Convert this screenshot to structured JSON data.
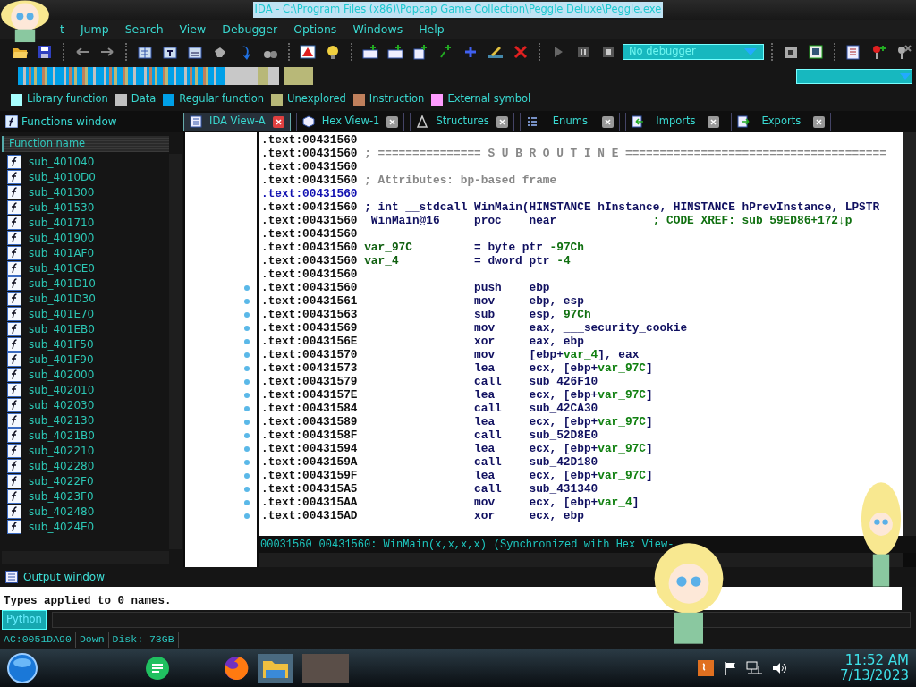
{
  "window": {
    "title": "IDA - C:\\Program Files (x86)\\Popcap Game Collection\\Peggle Deluxe\\Peggle.exe"
  },
  "menu": [
    "t",
    "Jump",
    "Search",
    "View",
    "Debugger",
    "Options",
    "Windows",
    "Help"
  ],
  "debugger_select": {
    "value": "No debugger"
  },
  "legend": [
    {
      "label": "Library function",
      "color": "#a8ffff"
    },
    {
      "label": "Data",
      "color": "#c0c0c0"
    },
    {
      "label": "Regular function",
      "color": "#00a0e8"
    },
    {
      "label": "Unexplored",
      "color": "#b8b878"
    },
    {
      "label": "Instruction",
      "color": "#c0805c"
    },
    {
      "label": "External symbol",
      "color": "#ff9cff"
    }
  ],
  "functions_window": {
    "title": "Functions window",
    "column": "Function name",
    "items": [
      "sub_401040",
      "sub_4010D0",
      "sub_401300",
      "sub_401530",
      "sub_401710",
      "sub_401900",
      "sub_401AF0",
      "sub_401CE0",
      "sub_401D10",
      "sub_401D30",
      "sub_401E70",
      "sub_401EB0",
      "sub_401F50",
      "sub_401F90",
      "sub_402000",
      "sub_402010",
      "sub_402030",
      "sub_402130",
      "sub_4021B0",
      "sub_402210",
      "sub_402280",
      "sub_4022F0",
      "sub_4023F0",
      "sub_402480",
      "sub_4024E0"
    ]
  },
  "tabs": [
    {
      "label": "IDA View-A",
      "selected": true,
      "kind": "listing"
    },
    {
      "label": "Hex View-1",
      "selected": false,
      "kind": "hex"
    },
    {
      "label": "Structures",
      "selected": false,
      "kind": "struct"
    },
    {
      "label": "Enums",
      "selected": false,
      "kind": "enum"
    },
    {
      "label": "Imports",
      "selected": false,
      "kind": "imports"
    },
    {
      "label": "Exports",
      "selected": false,
      "kind": "exports"
    }
  ],
  "listing": {
    "lines": [
      {
        "addr": ".text:00431560",
        "selected": false
      },
      {
        "addr": ".text:00431560",
        "selected": false,
        "comment": "; =============== S U B R O U T I N E ======================================",
        "dark": false
      },
      {
        "addr": ".text:00431560",
        "selected": false
      },
      {
        "addr": ".text:00431560",
        "selected": false,
        "comment": "; Attributes: bp-based frame",
        "dark": false
      },
      {
        "addr": ".text:00431560",
        "selected": true
      },
      {
        "addr": ".text:00431560",
        "selected": false,
        "comment": "; int __stdcall WinMain(HINSTANCE hInstance, HINSTANCE hPrevInstance, LPSTR",
        "dark": true
      },
      {
        "addr": ".text:00431560",
        "selected": false,
        "label": "_WinMain@16",
        "var": false,
        "code": [
          {
            "kind": "mnem",
            "text": "proc"
          },
          {
            "kind": "op",
            "text": "near"
          }
        ],
        "comment": "; CODE XREF: sub_59ED86+172↓p"
      },
      {
        "addr": ".text:00431560",
        "selected": false
      },
      {
        "addr": ".text:00431560",
        "selected": false,
        "label": "var_97C",
        "var": true,
        "code": [
          {
            "kind": "op",
            "text": "= byte ptr "
          },
          {
            "kind": "num",
            "text": "-97Ch"
          }
        ]
      },
      {
        "addr": ".text:00431560",
        "selected": false,
        "label": "var_4",
        "var": true,
        "code": [
          {
            "kind": "op",
            "text": "= dword ptr "
          },
          {
            "kind": "num",
            "text": "-4"
          }
        ]
      },
      {
        "addr": ".text:00431560",
        "selected": false
      },
      {
        "addr": ".text:00431560",
        "selected": false,
        "dot": true,
        "code": [
          {
            "kind": "mnem",
            "text": "push"
          },
          {
            "kind": "op",
            "text": "ebp"
          }
        ]
      },
      {
        "addr": ".text:00431561",
        "selected": false,
        "dot": true,
        "code": [
          {
            "kind": "mnem",
            "text": "mov"
          },
          {
            "kind": "op",
            "text": "ebp, esp"
          }
        ]
      },
      {
        "addr": ".text:00431563",
        "selected": false,
        "dot": true,
        "code": [
          {
            "kind": "mnem",
            "text": "sub"
          },
          {
            "kind": "op",
            "text": "esp, "
          },
          {
            "kind": "num",
            "text": "97Ch"
          }
        ]
      },
      {
        "addr": ".text:00431569",
        "selected": false,
        "dot": true,
        "code": [
          {
            "kind": "mnem",
            "text": "mov"
          },
          {
            "kind": "op",
            "text": "eax, ___security_cookie"
          }
        ]
      },
      {
        "addr": ".text:0043156E",
        "selected": false,
        "dot": true,
        "code": [
          {
            "kind": "mnem",
            "text": "xor"
          },
          {
            "kind": "op",
            "text": "eax, ebp"
          }
        ]
      },
      {
        "addr": ".text:00431570",
        "selected": false,
        "dot": true,
        "code": [
          {
            "kind": "mnem",
            "text": "mov"
          },
          {
            "kind": "op",
            "text": "[ebp+"
          },
          {
            "kind": "var",
            "text": "var_4"
          },
          {
            "kind": "op",
            "text": "], eax"
          }
        ]
      },
      {
        "addr": ".text:00431573",
        "selected": false,
        "dot": true,
        "code": [
          {
            "kind": "mnem",
            "text": "lea"
          },
          {
            "kind": "op",
            "text": "ecx, [ebp+"
          },
          {
            "kind": "var",
            "text": "var_97C"
          },
          {
            "kind": "op",
            "text": "]"
          }
        ]
      },
      {
        "addr": ".text:00431579",
        "selected": false,
        "dot": true,
        "code": [
          {
            "kind": "mnem",
            "text": "call"
          },
          {
            "kind": "op",
            "text": "sub_426F10"
          }
        ]
      },
      {
        "addr": ".text:0043157E",
        "selected": false,
        "dot": true,
        "code": [
          {
            "kind": "mnem",
            "text": "lea"
          },
          {
            "kind": "op",
            "text": "ecx, [ebp+"
          },
          {
            "kind": "var",
            "text": "var_97C"
          },
          {
            "kind": "op",
            "text": "]"
          }
        ]
      },
      {
        "addr": ".text:00431584",
        "selected": false,
        "dot": true,
        "code": [
          {
            "kind": "mnem",
            "text": "call"
          },
          {
            "kind": "op",
            "text": "sub_42CA30"
          }
        ]
      },
      {
        "addr": ".text:00431589",
        "selected": false,
        "dot": true,
        "code": [
          {
            "kind": "mnem",
            "text": "lea"
          },
          {
            "kind": "op",
            "text": "ecx, [ebp+"
          },
          {
            "kind": "var",
            "text": "var_97C"
          },
          {
            "kind": "op",
            "text": "]"
          }
        ]
      },
      {
        "addr": ".text:0043158F",
        "selected": false,
        "dot": true,
        "code": [
          {
            "kind": "mnem",
            "text": "call"
          },
          {
            "kind": "op",
            "text": "sub_52D8E0"
          }
        ]
      },
      {
        "addr": ".text:00431594",
        "selected": false,
        "dot": true,
        "code": [
          {
            "kind": "mnem",
            "text": "lea"
          },
          {
            "kind": "op",
            "text": "ecx, [ebp+"
          },
          {
            "kind": "var",
            "text": "var_97C"
          },
          {
            "kind": "op",
            "text": "]"
          }
        ]
      },
      {
        "addr": ".text:0043159A",
        "selected": false,
        "dot": true,
        "code": [
          {
            "kind": "mnem",
            "text": "call"
          },
          {
            "kind": "op",
            "text": "sub_42D180"
          }
        ]
      },
      {
        "addr": ".text:0043159F",
        "selected": false,
        "dot": true,
        "code": [
          {
            "kind": "mnem",
            "text": "lea"
          },
          {
            "kind": "op",
            "text": "ecx, [ebp+"
          },
          {
            "kind": "var",
            "text": "var_97C"
          },
          {
            "kind": "op",
            "text": "]"
          }
        ]
      },
      {
        "addr": ".text:004315A5",
        "selected": false,
        "dot": true,
        "code": [
          {
            "kind": "mnem",
            "text": "call"
          },
          {
            "kind": "op",
            "text": "sub_431340"
          }
        ]
      },
      {
        "addr": ".text:004315AA",
        "selected": false,
        "dot": true,
        "code": [
          {
            "kind": "mnem",
            "text": "mov"
          },
          {
            "kind": "op",
            "text": "ecx, [ebp+"
          },
          {
            "kind": "var",
            "text": "var_4"
          },
          {
            "kind": "op",
            "text": "]"
          }
        ]
      },
      {
        "addr": ".text:004315AD",
        "selected": false,
        "dot": true,
        "code": [
          {
            "kind": "mnem",
            "text": "xor"
          },
          {
            "kind": "op",
            "text": "ecx, ebp"
          }
        ]
      }
    ],
    "status": [
      "00031560",
      "00431560: WinMain(x,x,x,x)",
      "(Synchronized with Hex View-"
    ]
  },
  "output_window": {
    "title": "Output window",
    "lines": [
      "Types applied to 0 names."
    ],
    "python_button": "Python"
  },
  "status_bar": [
    "AC:0051DA90",
    "Down",
    "Disk: 73GB"
  ],
  "taskbar": {
    "time": "11:52 AM",
    "date": "7/13/2023"
  }
}
